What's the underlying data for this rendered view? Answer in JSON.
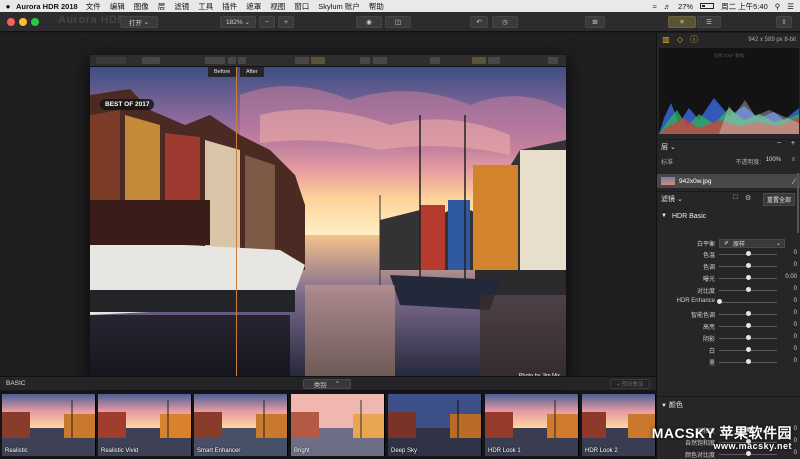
{
  "menubar": {
    "apple": "",
    "app_name": "Aurora HDR 2018",
    "items": [
      "文件",
      "编辑",
      "图像",
      "层",
      "滤镜",
      "工具",
      "插件",
      "遮罩",
      "视图",
      "窗口",
      "Skylum 账户",
      "帮助"
    ],
    "battery": "27%",
    "clock": "周二 上午5:40"
  },
  "toolbar": {
    "ghost_title": "Aurora HDR",
    "open_label": "打开",
    "zoom": "182%",
    "zoom_minus": "−",
    "zoom_plus": "+",
    "bit_depth": "8-bit"
  },
  "photo": {
    "before_label": "Before",
    "after_label": "After",
    "badge": "BEST OF 2017",
    "credit": "Photo by Jim Nix"
  },
  "presets": {
    "category_label": "BASIC",
    "dropdown_label": "类别",
    "add_label": "+ 预设叠加",
    "thumbs": [
      "Realistic",
      "Realistic Vivid",
      "Smart Enhancer",
      "Bright",
      "Deep Sky",
      "HDR Look 1",
      "HDR Look 2"
    ]
  },
  "panel": {
    "dimensions": "942 x 589 px   8-bit",
    "histogram_note": "没有 EXIF 数据",
    "layers_title": "层",
    "blend_mode": "标准",
    "opacity_label": "不透明度:",
    "opacity_value": "100%",
    "layer_name": "942x0w.jpg",
    "filters_title": "滤镜",
    "reset_all": "重置全部",
    "hdr_basic_title": "HDR Basic",
    "white_balance_label": "白平衡",
    "white_balance_value": "原样",
    "sliders": [
      {
        "label": "色温",
        "value": "0",
        "pos": 0.5
      },
      {
        "label": "色调",
        "value": "0",
        "pos": 0.5
      },
      {
        "label": "曝光",
        "value": "0.00",
        "pos": 0.5
      },
      {
        "label": "对比度",
        "value": "0",
        "pos": 0.5
      },
      {
        "label": "HDR Enhance",
        "value": "0",
        "pos": 0.0
      },
      {
        "label": "智能色调",
        "value": "0",
        "pos": 0.5
      },
      {
        "label": "高亮",
        "value": "0",
        "pos": 0.5
      },
      {
        "label": "阴影",
        "value": "0",
        "pos": 0.5
      },
      {
        "label": "白",
        "value": "0",
        "pos": 0.5
      },
      {
        "label": "黑",
        "value": "0",
        "pos": 0.5
      }
    ],
    "color_title": "颜色",
    "color_sliders": [
      {
        "label": "饱和度",
        "value": "0",
        "pos": 0.5
      },
      {
        "label": "自然饱和度",
        "value": "0",
        "pos": 0.5
      },
      {
        "label": "颜色对比度",
        "value": "0",
        "pos": 0.5
      }
    ]
  },
  "watermark": {
    "brand": "MACSKY 苹果软件园",
    "url": "www.macsky.net"
  },
  "colors": {
    "accent": "#f0b429",
    "active_button": "#5a5336"
  }
}
